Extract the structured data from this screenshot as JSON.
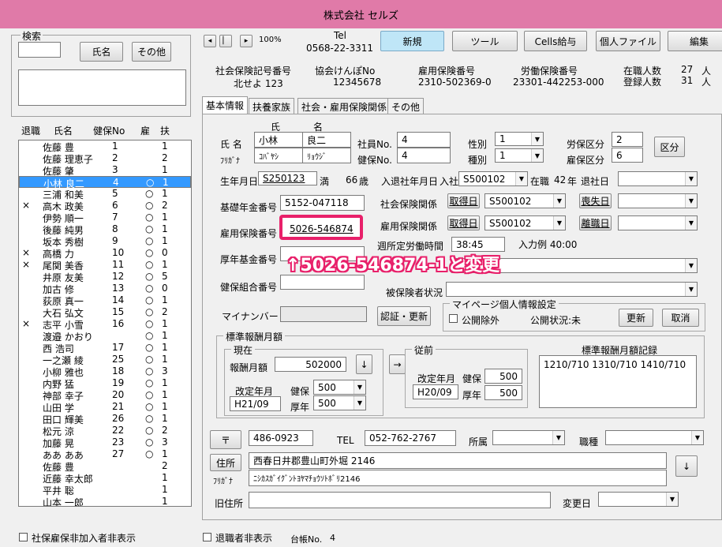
{
  "window": {
    "title": "株式会社 セルズ"
  },
  "search": {
    "label": "検索",
    "value": "",
    "name_btn": "氏名",
    "other_btn": "その他",
    "memo": ""
  },
  "list": {
    "headers": {
      "retire": "退職",
      "name": "氏名",
      "kenpo": "健保No",
      "emp": "雇",
      "dep": "扶"
    },
    "rows": [
      {
        "mark": "",
        "name": "佐藤 豊",
        "no": "1",
        "emp": "",
        "dep": "1"
      },
      {
        "mark": "",
        "name": "佐藤 理恵子",
        "no": "2",
        "emp": "",
        "dep": "2"
      },
      {
        "mark": "",
        "name": "佐藤 肇",
        "no": "3",
        "emp": "",
        "dep": "1"
      },
      {
        "mark": "",
        "name": "小林 良二",
        "no": "4",
        "emp": "○",
        "dep": "1"
      },
      {
        "mark": "",
        "name": "三浦 和美",
        "no": "5",
        "emp": "○",
        "dep": "1"
      },
      {
        "mark": "×",
        "name": "高木 政美",
        "no": "6",
        "emp": "○",
        "dep": "2"
      },
      {
        "mark": "",
        "name": "伊勢 順一",
        "no": "7",
        "emp": "○",
        "dep": "1"
      },
      {
        "mark": "",
        "name": "後藤 純男",
        "no": "8",
        "emp": "○",
        "dep": "1"
      },
      {
        "mark": "",
        "name": "坂本 秀樹",
        "no": "9",
        "emp": "○",
        "dep": "1"
      },
      {
        "mark": "×",
        "name": "高橋 力",
        "no": "10",
        "emp": "○",
        "dep": "0"
      },
      {
        "mark": "×",
        "name": "尾関 美香",
        "no": "11",
        "emp": "○",
        "dep": "1"
      },
      {
        "mark": "",
        "name": "井原 友美",
        "no": "12",
        "emp": "○",
        "dep": "5"
      },
      {
        "mark": "",
        "name": "加古 修",
        "no": "13",
        "emp": "○",
        "dep": "0"
      },
      {
        "mark": "",
        "name": "荻原 真一",
        "no": "14",
        "emp": "○",
        "dep": "1"
      },
      {
        "mark": "",
        "name": "大石 弘文",
        "no": "15",
        "emp": "○",
        "dep": "2"
      },
      {
        "mark": "×",
        "name": "志平 小雪",
        "no": "16",
        "emp": "○",
        "dep": "1"
      },
      {
        "mark": "",
        "name": "渡邉 かおり",
        "no": "",
        "emp": "○",
        "dep": "1"
      },
      {
        "mark": "",
        "name": "西 浩司",
        "no": "17",
        "emp": "○",
        "dep": "1"
      },
      {
        "mark": "",
        "name": "一之瀬 綾",
        "no": "25",
        "emp": "○",
        "dep": "1"
      },
      {
        "mark": "",
        "name": "小柳 雅也",
        "no": "18",
        "emp": "○",
        "dep": "3"
      },
      {
        "mark": "",
        "name": "内野 猛",
        "no": "19",
        "emp": "○",
        "dep": "1"
      },
      {
        "mark": "",
        "name": "神部 幸子",
        "no": "20",
        "emp": "○",
        "dep": "1"
      },
      {
        "mark": "",
        "name": "山田 学",
        "no": "21",
        "emp": "○",
        "dep": "1"
      },
      {
        "mark": "",
        "name": "田口 輝美",
        "no": "26",
        "emp": "○",
        "dep": "1"
      },
      {
        "mark": "",
        "name": "松元 涼",
        "no": "22",
        "emp": "○",
        "dep": "2"
      },
      {
        "mark": "",
        "name": "加藤 晃",
        "no": "23",
        "emp": "○",
        "dep": "3"
      },
      {
        "mark": "",
        "name": "ああ ああ",
        "no": "27",
        "emp": "○",
        "dep": "1"
      },
      {
        "mark": "",
        "name": "佐藤 豊",
        "no": "",
        "emp": "",
        "dep": "2"
      },
      {
        "mark": "",
        "name": "近藤 幸太郎",
        "no": "",
        "emp": "",
        "dep": "1"
      },
      {
        "mark": "",
        "name": "平井 聡",
        "no": "",
        "emp": "",
        "dep": "1"
      },
      {
        "mark": "",
        "name": "山本 一郎",
        "no": "",
        "emp": "",
        "dep": "1"
      }
    ]
  },
  "bottom_left": {
    "checkbox": "社保雇保非加入者非表示"
  },
  "toolbar": {
    "nav_first": "◂",
    "nav_prev": "▏",
    "nav_next": "▸",
    "zoom": "100%",
    "tel_label": "Tel",
    "tel_value": "0568-22-3311",
    "new": "新規",
    "tool": "ツール",
    "cells_pay": "Cells給与",
    "personal_file": "個人ファイル",
    "edit": "編集"
  },
  "info": {
    "shaho_label": "社会保険記号番号",
    "shaho_value": "北せよ 123",
    "kyokai_label": "協会けんぽNo",
    "kyokai_value": "12345678",
    "koyo_label": "雇用保険番号",
    "koyo_value": "2310-502369-0",
    "rodo_label": "労働保険番号",
    "rodo_value": "23301-442253-000",
    "zaishoku_label": "在職人数",
    "zaishoku_value": "27",
    "zaishoku_unit": "人",
    "toroku_label": "登録人数",
    "toroku_value": "31",
    "toroku_unit": "人"
  },
  "tabs": [
    "基本情報",
    "扶養家族",
    "社会・雇用保険関係",
    "その他"
  ],
  "basic": {
    "name_label": "氏 名",
    "furigana_label": "ﾌﾘｶﾞﾅ",
    "sei_label": "氏",
    "mei_label": "名",
    "sei": "小林",
    "mei": "良二",
    "sei_kana": "ｺﾊﾞﾔｼ",
    "mei_kana": "ﾘｮｳｼﾞ",
    "shain_label": "社員No.",
    "shain_value": "4",
    "kenpo_label": "健保No.",
    "kenpo_value": "4",
    "seibetsu_label": "性別",
    "seibetsu_value": "1",
    "shubetsu_label": "種別",
    "shubetsu_value": "1",
    "rouho_label": "労保区分",
    "rouho_value": "2",
    "koho_label": "雇保区分",
    "koho_value": "6",
    "kubun_btn": "区分",
    "birth_label": "生年月日",
    "birth_value": "S250123",
    "age_prefix": "満",
    "age_value": "66",
    "age_unit": "歳",
    "nyutai_label": "入退社年月日",
    "nyusha_label": "入社",
    "nyusha_value": "S500102",
    "zaishoku_label": "在職",
    "zaishoku_years": "42",
    "year_unit": "年",
    "taisha_label": "退社日",
    "taisha_value": "",
    "kiso_label": "基礎年金番号",
    "kiso_value": "5152-047118",
    "shakai_label": "社会保険関係",
    "shutoku_btn": "取得日",
    "shakai_date": "S500102",
    "soshitsu_btn": "喪失日",
    "soshitsu_value": "",
    "koyo_label": "雇用保険番号",
    "koyo_value": "5026-546874",
    "koyo_rel_label": "雇用保険関係",
    "koyo_date": "S500102",
    "rishoku_btn": "離職日",
    "rishoku_value": "",
    "shotei_label": "週所定労働時間",
    "shotei_value": "38:45",
    "input_example": "入力例 40:00",
    "kosei_label": "厚年基金番号",
    "kosei_value": "",
    "kenpo_kumiai_label": "健保組合番号",
    "kenpo_kumiai_value": "",
    "hihoken_label": "被保険者状況",
    "hihoken_value": "",
    "annotation": "↑5026-546874-1と変更",
    "mynumber_label": "マイナンバー",
    "mynumber_value": "",
    "auth_btn": "認証・更新",
    "mypage_title": "マイページ個人情報設定",
    "kokai_jogai": "公開除外",
    "kokai_status": "公開状況:未",
    "update_btn": "更新",
    "cancel_btn": "取消"
  },
  "hyojun": {
    "title": "標準報酬月額",
    "current_title": "現在",
    "housyu_label": "報酬月額",
    "housyu_value": "502000",
    "kaitei_label": "改定年月",
    "kaitei_value": "H21/09",
    "kenpo_label": "健保",
    "kenpo_value": "500",
    "kosei_label": "厚年",
    "kosei_value": "500",
    "down_btn": "↓",
    "arrow_btn": "→",
    "prev_title": "従前",
    "prev_kaitei_label": "改定年月",
    "prev_kaitei_value": "H20/09",
    "prev_kenpo_label": "健保",
    "prev_kenpo_value": "500",
    "prev_kosei_label": "厚年",
    "prev_kosei_value": "500",
    "record_title": "標準報酬月額記録",
    "record_value": "1210/710 1310/710 1410/710"
  },
  "address": {
    "zip_btn": "〒",
    "zip_value": "486-0923",
    "tel_label": "TEL",
    "tel_value": "052-762-2767",
    "shozoku_label": "所属",
    "shozoku_value": "",
    "shokushu_label": "職種",
    "shokushu_value": "",
    "addr_btn": "住所",
    "addr_value": "西春日井郡豊山町外堀 2146",
    "kana_label": "ﾌﾘｶﾞﾅ",
    "kana_value": "ﾆｼｶｽｶﾞｲｸﾞﾝﾄﾖﾔﾏﾁｮｳｿﾄﾎﾞﾘ2146",
    "down_btn": "↓",
    "old_addr_label": "旧住所",
    "old_addr_value": "",
    "henko_label": "変更日",
    "henko_value": ""
  },
  "bottom": {
    "retired_checkbox": "退職者非表示",
    "daicho_label": "台帳No.",
    "daicho_value": "4"
  },
  "colors": {
    "title_bar": "#e07aa8",
    "selected_row": "#3399ff",
    "highlight_border": "#e8206a",
    "annotation_text": "#ffffff",
    "annotation_stroke": "#e8206a"
  }
}
